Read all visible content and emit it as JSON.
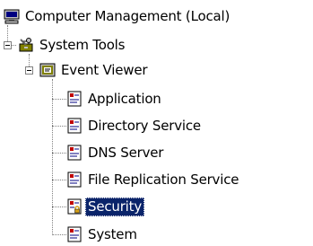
{
  "tree": {
    "root": {
      "label": "Computer Management (Local)",
      "icon": "computer-icon"
    },
    "system_tools": {
      "label": "System Tools",
      "icon": "toolbox-icon",
      "expander": "collapse"
    },
    "event_viewer": {
      "label": "Event Viewer",
      "icon": "event-viewer-icon",
      "expander": "collapse"
    },
    "logs": [
      {
        "label": "Application",
        "icon": "event-log-icon"
      },
      {
        "label": "Directory Service",
        "icon": "event-log-icon"
      },
      {
        "label": "DNS Server",
        "icon": "event-log-icon"
      },
      {
        "label": "File Replication Service",
        "icon": "event-log-icon"
      },
      {
        "label": "Security",
        "icon": "security-log-icon",
        "selected": true
      },
      {
        "label": "System",
        "icon": "event-log-icon"
      }
    ]
  },
  "colors": {
    "selection_background": "#0a246a",
    "selection_text": "#ffffff",
    "log_icon_red": "#c00000",
    "security_icon_gold": "#d4a017"
  }
}
